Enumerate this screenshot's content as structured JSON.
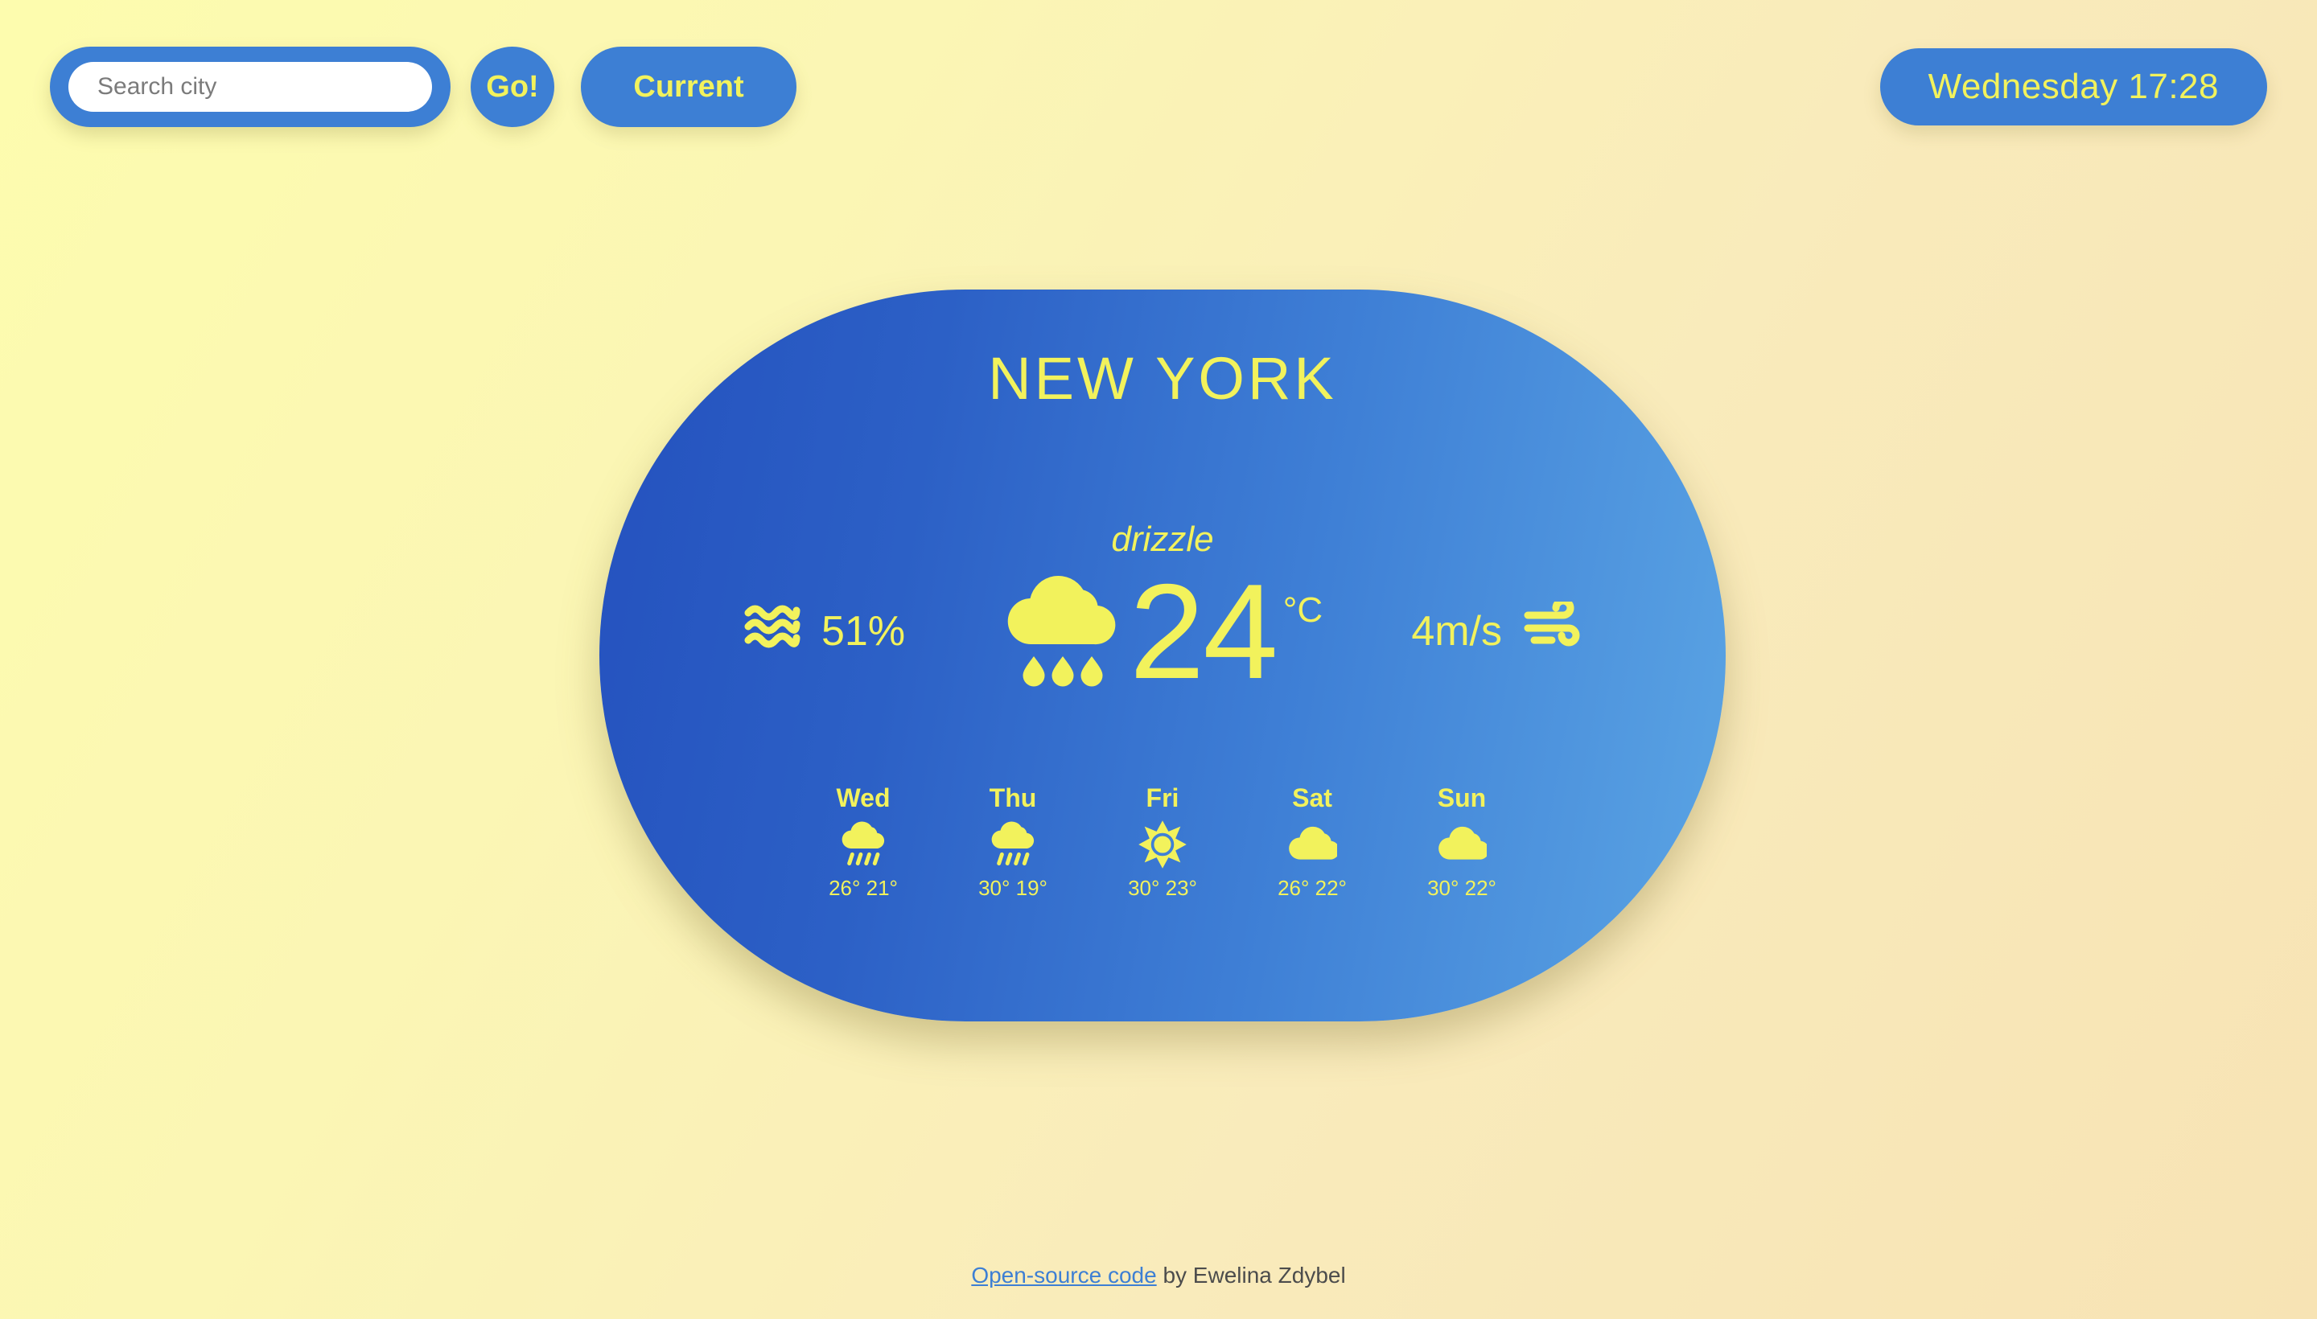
{
  "colors": {
    "accent_blue": "#3d7fd4",
    "card_blue_dark": "#2451be",
    "card_blue_light": "#5ba5e4",
    "accent_yellow": "#f2f25c",
    "page_bg_yellow": "#fdfcae",
    "page_bg_cream": "#f7e3b4",
    "link_blue": "#3d7fd4",
    "footer_text": "#4c4c4c"
  },
  "search": {
    "placeholder": "Search city",
    "value": "",
    "go_label": "Go!",
    "current_label": "Current"
  },
  "datetime": {
    "label": "Wednesday 17:28",
    "weekday": "Wednesday",
    "time": "17:28"
  },
  "weather": {
    "city": "NEW YORK",
    "condition": "drizzle",
    "condition_icon": "drizzle-cloud-icon",
    "temperature": "24",
    "unit": "°C",
    "humidity": "51%",
    "humidity_icon": "humidity-waves-icon",
    "wind": "4m/s",
    "wind_icon": "wind-icon"
  },
  "forecast": [
    {
      "day": "Wed",
      "icon": "rain-cloud-icon",
      "temps": "26° 21°",
      "high": "26°",
      "low": "21°"
    },
    {
      "day": "Thu",
      "icon": "rain-cloud-icon",
      "temps": "30° 19°",
      "high": "30°",
      "low": "19°"
    },
    {
      "day": "Fri",
      "icon": "sun-icon",
      "temps": "30° 23°",
      "high": "30°",
      "low": "23°"
    },
    {
      "day": "Sat",
      "icon": "cloud-icon",
      "temps": "26° 22°",
      "high": "26°",
      "low": "22°"
    },
    {
      "day": "Sun",
      "icon": "cloud-icon",
      "temps": "30° 22°",
      "high": "30°",
      "low": "22°"
    }
  ],
  "footer": {
    "link_text": "Open-source code",
    "rest_text": " by Ewelina Zdybel"
  }
}
